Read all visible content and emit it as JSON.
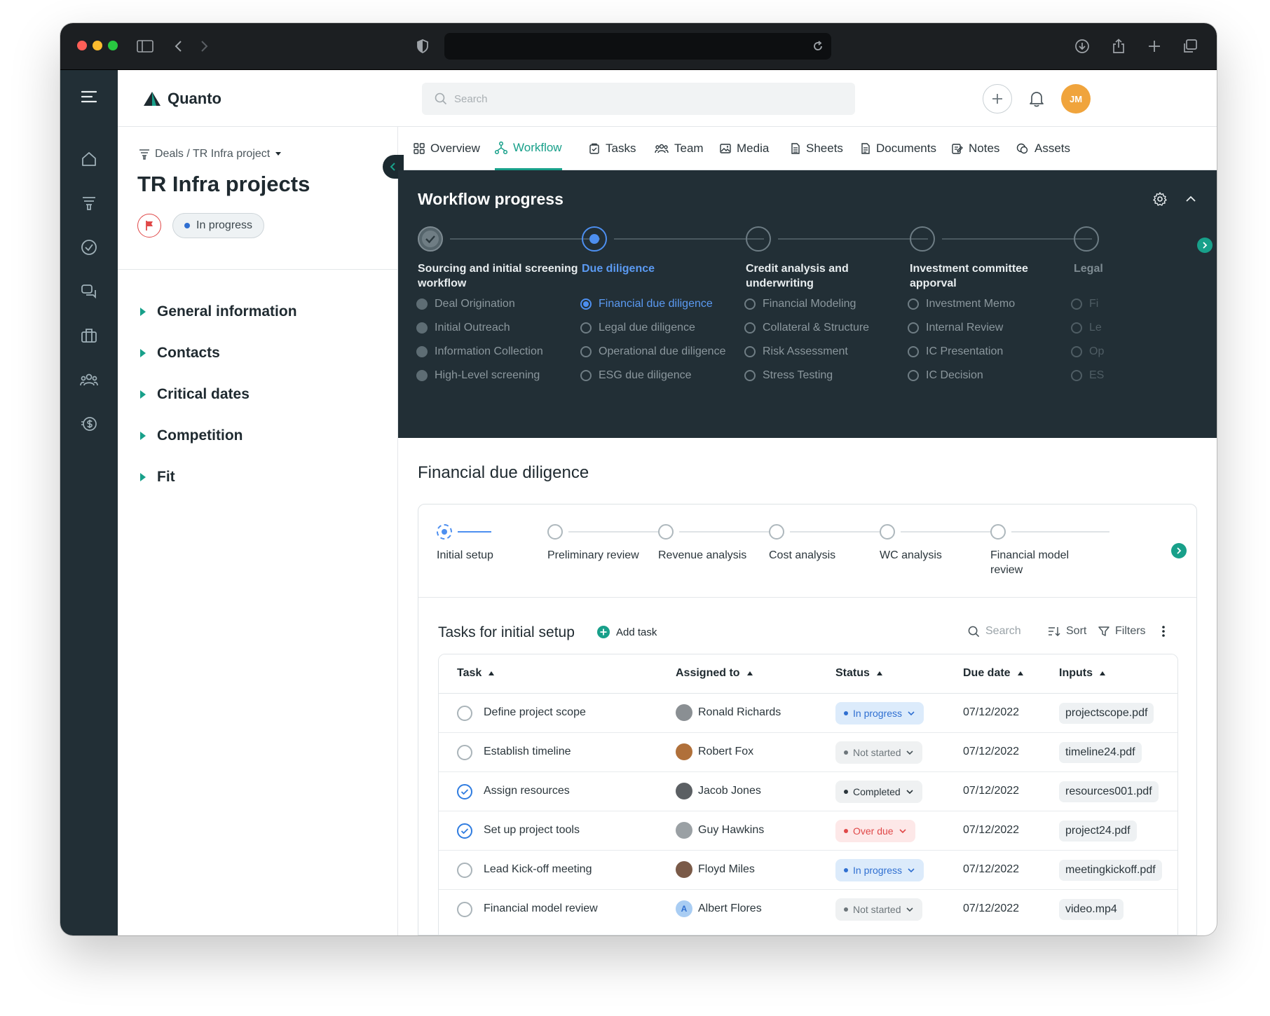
{
  "browser": {
    "url": ""
  },
  "app": {
    "name": "Quanto",
    "search_placeholder": "Search",
    "avatar_initials": "JM"
  },
  "project": {
    "breadcrumb": "Deals / TR Infra project",
    "title": "TR Infra projects",
    "status": "In progress"
  },
  "sections": [
    "General information",
    "Contacts",
    "Critical dates",
    "Competition",
    "Fit"
  ],
  "tabs": [
    "Overview",
    "Workflow",
    "Tasks",
    "Team",
    "Media",
    "Sheets",
    "Documents",
    "Notes",
    "Assets"
  ],
  "active_tab": "Workflow",
  "workflow": {
    "title": "Workflow progress",
    "stages": [
      {
        "label": "Sourcing and initial screening workflow",
        "state": "done",
        "items": [
          "Deal Origination",
          "Initial Outreach",
          "Information Collection",
          "High-Level screening"
        ]
      },
      {
        "label": "Due diligence",
        "state": "active",
        "items": [
          "Financial due diligence",
          "Legal due diligence",
          "Operational due diligence",
          "ESG due diligence"
        ]
      },
      {
        "label": "Credit analysis and underwriting",
        "state": "todo",
        "items": [
          "Financial Modeling",
          "Collateral & Structure",
          "Risk Assessment",
          "Stress Testing"
        ]
      },
      {
        "label": "Investment committee apporval",
        "state": "todo",
        "items": [
          "Investment Memo",
          "Internal Review",
          "IC Presentation",
          "IC Decision"
        ]
      },
      {
        "label": "Legal",
        "state": "todo",
        "items": [
          "Fi",
          "Le",
          "Op",
          "ES"
        ]
      }
    ]
  },
  "fdd": {
    "title": "Financial due diligence",
    "steps": [
      "Initial setup",
      "Preliminary review",
      "Revenue analysis",
      "Cost analysis",
      "WC analysis",
      "Financial model review"
    ],
    "tasks_title": "Tasks for initial setup",
    "add_task": "Add task",
    "search_label": "Search",
    "sort_label": "Sort",
    "filters_label": "Filters"
  },
  "table": {
    "columns": [
      "Task",
      "Assigned to",
      "Status",
      "Due date",
      "Inputs"
    ],
    "rows": [
      {
        "task": "Define project scope",
        "done": false,
        "assignee": "Ronald Richards",
        "status": "In progress",
        "due": "07/12/2022",
        "input": "projectscope.pdf"
      },
      {
        "task": "Establish timeline",
        "done": false,
        "assignee": "Robert Fox",
        "status": "Not started",
        "due": "07/12/2022",
        "input": "timeline24.pdf"
      },
      {
        "task": "Assign resources",
        "done": true,
        "assignee": "Jacob Jones",
        "status": "Completed",
        "due": "07/12/2022",
        "input": "resources001.pdf"
      },
      {
        "task": "Set up project tools",
        "done": true,
        "assignee": "Guy Hawkins",
        "status": "Over due",
        "due": "07/12/2022",
        "input": "project24.pdf"
      },
      {
        "task": "Lead Kick-off meeting",
        "done": false,
        "assignee": "Floyd Miles",
        "status": "In progress",
        "due": "07/12/2022",
        "input": "meetingkickoff.pdf"
      },
      {
        "task": "Financial model review",
        "done": false,
        "assignee": "Albert Flores",
        "status": "Not started",
        "due": "07/12/2022",
        "input": "video.mp4"
      }
    ]
  },
  "avatar_initial_last": "A",
  "colors": {
    "accent": "#18a08a",
    "dark": "#222f36",
    "blue": "#4d8ff0",
    "avatar": "#f0a43c"
  }
}
